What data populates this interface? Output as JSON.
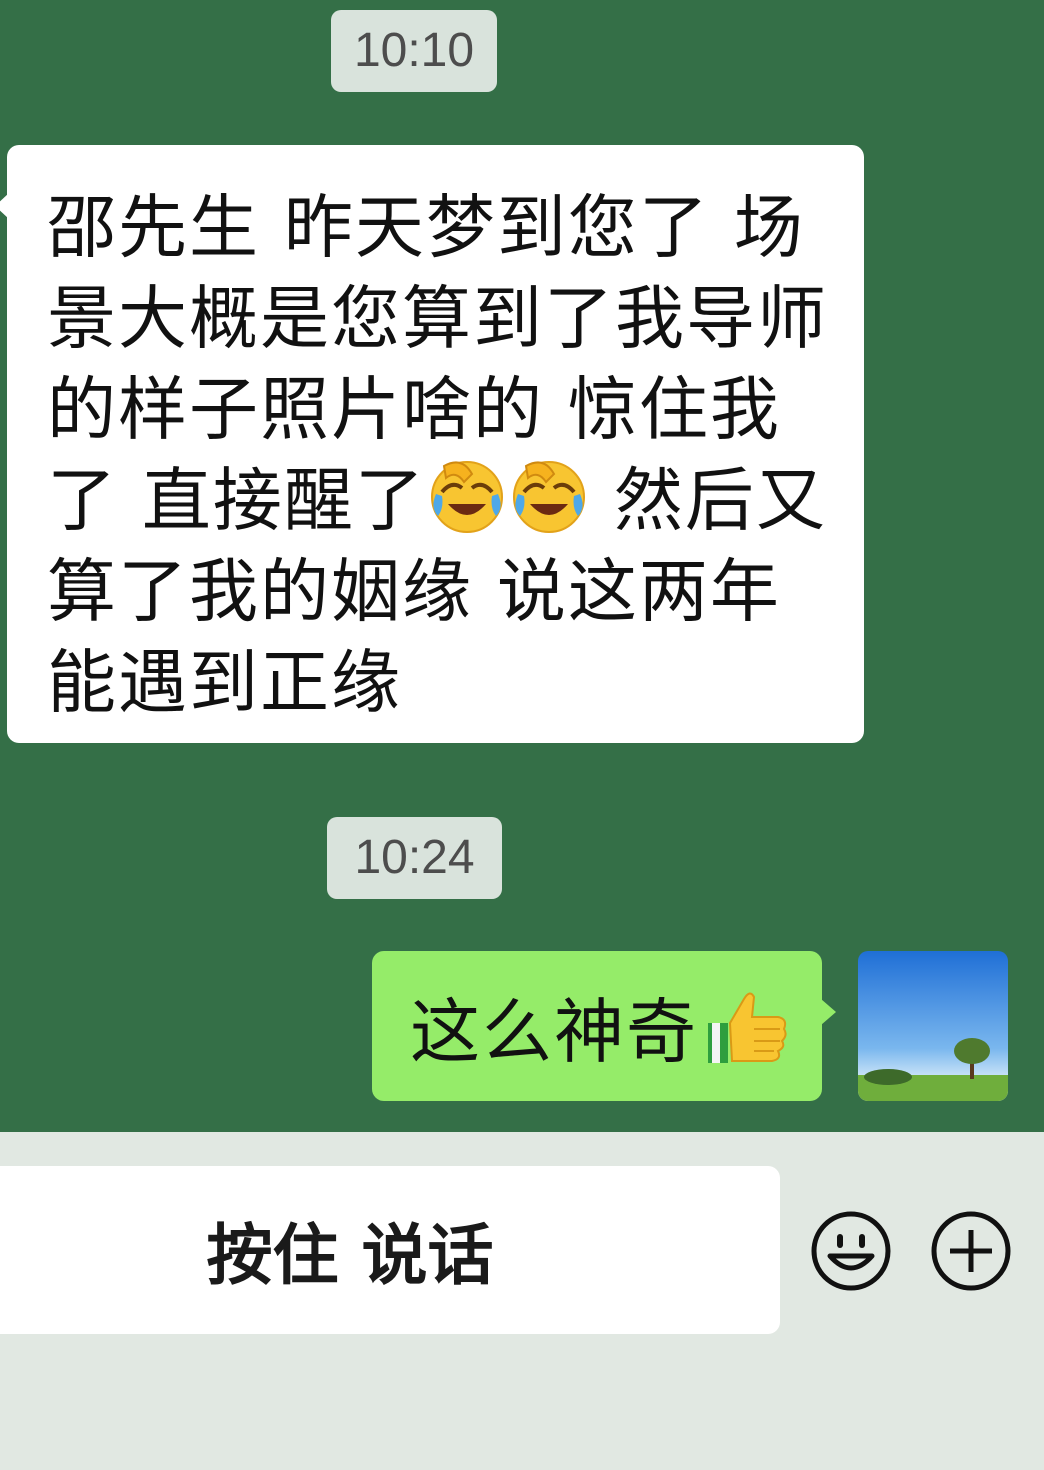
{
  "chat": {
    "timestamps": [
      "10:10",
      "10:24"
    ],
    "incoming_message": {
      "part1": "邵先生  昨天梦到您了  场景大概是您算到了我导师的样子照片啥的  惊住我了  直接醒了",
      "emoji": "face-with-tears-of-joy",
      "part2": "  然后又算了我的姻缘  说这两年能遇到正缘"
    },
    "outgoing_message": {
      "text": "这么神奇",
      "emoji": "thumbs-up"
    }
  },
  "input_bar": {
    "hold_to_talk_label": "按住 说话",
    "emoji_icon": "smiley-icon",
    "plus_icon": "plus-circle-icon"
  },
  "colors": {
    "chat_background": "#346f47",
    "incoming_bubble": "#ffffff",
    "outgoing_bubble": "#95ec69",
    "input_bar_background": "#e1e8e2"
  }
}
